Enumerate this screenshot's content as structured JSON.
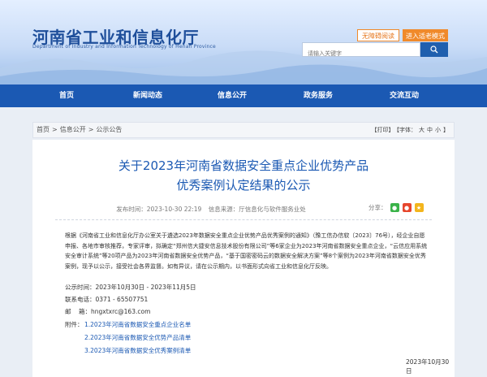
{
  "header": {
    "title_cn": "河南省工业和信息化厅",
    "title_en": "Department of Industry and Information Technology of Henan Province",
    "accessible_label": "无障碍阅读",
    "elder_label": "进入适老模式",
    "search_placeholder": "请输入关键字"
  },
  "nav": [
    "首页",
    "新闻动态",
    "信息公开",
    "政务服务",
    "交流互动"
  ],
  "breadcrumb": [
    "首页",
    ">",
    "信息公开",
    ">",
    "公示公告"
  ],
  "tools": {
    "print": "【打印】",
    "font": "【字体：",
    "big": "大",
    "mid": "中",
    "small": "小",
    "end": "】"
  },
  "article": {
    "title_line1": "关于2023年河南省数据安全重点企业优势产品",
    "title_line2": "优秀案例认定结果的公示",
    "publish_time": "发布时间：2023-10-30 22:19",
    "source": "信息来源：厅信息化与软件服务业处",
    "share_label": "分享：",
    "body": "根据《河南省工业和信息化厅办公室关于遴选2023年数据安全重点企业优势产品优秀案例的通知》（豫工信办信软〔2023〕76号），经企业自愿申报、各地市审核推荐，专家评审，拟确定“郑州信大捷安信息技术股份有限公司”等6家企业为2023年河南省数据安全重点企业，“云信应用系统安全审计系统”等20项产品为2023年河南省数据安全优势产品，“基于国密密码云的数据安全解决方案”等8个案例为2023年河南省数据安全优秀案例，现予以公示，接受社会各界监督。如有异议，请在公示期内，以书面形式向省工业和信息化厅反映。",
    "period": "公示时间：2023年10月30日 - 2023年11月5日",
    "phone": "联系电话：0371 - 65507751",
    "email": "邮    箱：hngxtxrc@163.com",
    "attach_label": "附件：",
    "attachments": [
      "1.2023年河南省数据安全重点企业名单",
      "2.2023年河南省数据安全优势产品清单",
      "3.2023年河南省数据安全优秀案例清单"
    ],
    "date": "2023年10月30日"
  }
}
